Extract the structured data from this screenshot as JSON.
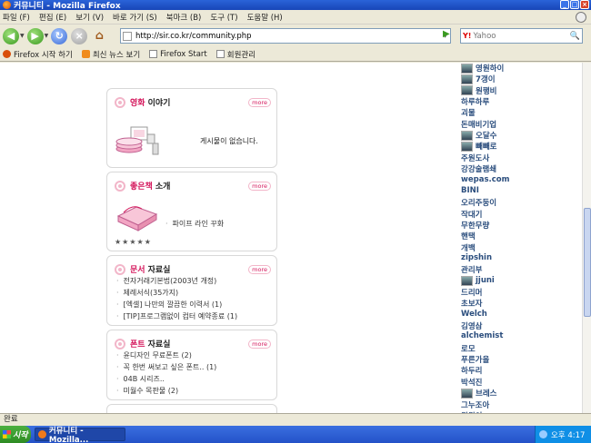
{
  "window": {
    "title": "커뮤니티 - Mozilla Firefox",
    "minimize": "_",
    "maximize": "□",
    "close": "×"
  },
  "menu": [
    "파일 (F)",
    "편집 (E)",
    "보기 (V)",
    "바로 가기 (S)",
    "북마크 (B)",
    "도구 (T)",
    "도움말 (H)"
  ],
  "navigation": {
    "back": "◀",
    "forward": "▶",
    "reload": "↻",
    "stop": "×",
    "home": "⌂",
    "url": "http://sir.co.kr/community.php",
    "go": "▶",
    "search_placeholder": "Yahoo",
    "search_engine": "Y!"
  },
  "bookmarks": [
    "Firefox 시작 하기",
    "최신 뉴스 보기",
    "Firefox Start",
    "회원관리"
  ],
  "boxes": [
    {
      "title_highlight": "영화",
      "title_rest": "이야기",
      "more": "more",
      "empty_text": "게시물이 없습니다."
    },
    {
      "title_highlight": "좋은책",
      "title_rest": "소개",
      "more": "more",
      "items": [
        "파이프 라인 꾸화"
      ],
      "rating": "★★★★★"
    },
    {
      "title_highlight": "문서",
      "title_rest": "자료실",
      "more": "more",
      "items": [
        "전자거래기본법(2003년 개정)",
        "제례서식(35가지)",
        "[엑셀] 나만의 깔끔한 이력서 (1)",
        "[TIP]프로그램없이 컴터 예약종료 (1)"
      ]
    },
    {
      "title_highlight": "폰트",
      "title_rest": "자료실",
      "more": "more",
      "items": [
        "윤디자인 무료폰트 (2)",
        "꼭 한번 써보고 싶은 폰트.. (1)",
        "04B 시리즈..",
        "미월수 목판물 (2)"
      ]
    }
  ],
  "users": [
    {
      "name": "영원하이",
      "avatar": true
    },
    {
      "name": "7갱이",
      "avatar": true
    },
    {
      "name": "원행비",
      "avatar": true
    },
    {
      "name": "하루하루"
    },
    {
      "name": "괴물"
    },
    {
      "name": "돈매비기업"
    },
    {
      "name": "오달수",
      "avatar": true
    },
    {
      "name": "빼빼로",
      "avatar": true
    },
    {
      "name": "주원도사"
    },
    {
      "name": "강강술램쇄"
    },
    {
      "name": "wepas.com"
    },
    {
      "name": "BINI"
    },
    {
      "name": "오리주둥이"
    },
    {
      "name": "작대기"
    },
    {
      "name": "무한무량"
    },
    {
      "name": "핸택"
    },
    {
      "name": "개백"
    },
    {
      "name": "zipshin"
    },
    {
      "name": "관리부"
    },
    {
      "name": "jjuni",
      "avatar": true
    },
    {
      "name": "드리머"
    },
    {
      "name": "초보자"
    },
    {
      "name": "Welch"
    },
    {
      "name": "김영삼"
    },
    {
      "name": "alchemist"
    },
    {
      "name": "로모"
    },
    {
      "name": "푸른가을"
    },
    {
      "name": "하두리"
    },
    {
      "name": "박석진"
    },
    {
      "name": "브레스",
      "avatar": true
    },
    {
      "name": "그누조아"
    },
    {
      "name": "월월이"
    }
  ],
  "status": "완료",
  "taskbar": {
    "start": "시작",
    "task": "커뮤니티 - Mozilla...",
    "clock": "오후 4:17"
  }
}
